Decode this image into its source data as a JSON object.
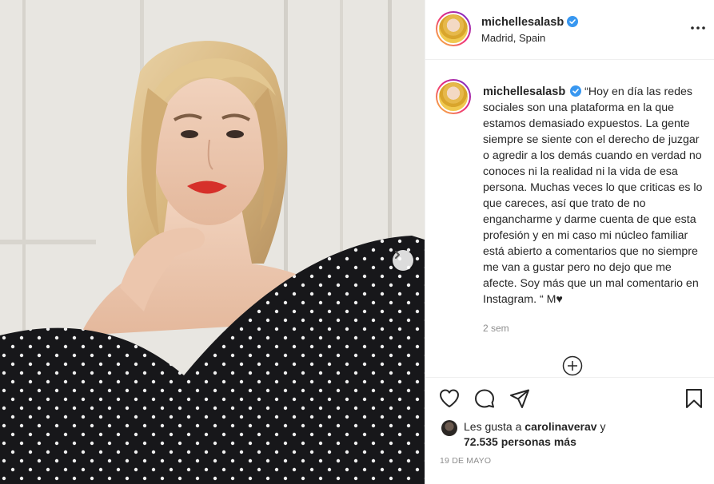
{
  "post": {
    "username": "michellesalasb",
    "location": "Madrid, Spain",
    "caption": "“Hoy en día las redes sociales son una plataforma en la que estamos demasiado expuestos. La gente siempre se siente con el derecho de juzgar o agredir a los demás cuando en verdad no conoces ni la realidad ni la vida de esa persona. Muchas veces lo que criticas es lo que careces, así que trato de no engancharme y darme cuenta de que esta profesión y en mi caso mi núcleo familiar está abierto a comentarios que no siempre me van a gustar pero no dejo que me afecte. Soy más que un mal comentario en Instagram. “ M♥",
    "time_ago": "2 sem",
    "date": "19 DE MAYO"
  },
  "likes": {
    "prefix": "Les gusta a",
    "liker": "carolinaverav",
    "conjunction": "y",
    "count": "72.535 personas más"
  },
  "icons": {
    "verified": "verified-badge-icon",
    "more": "more-options-icon",
    "next": "chevron-right-icon",
    "load_more": "plus-circle-icon",
    "like": "heart-icon",
    "comment": "comment-icon",
    "share": "paper-plane-icon",
    "save": "bookmark-icon"
  },
  "colors": {
    "verified": "#3897f0",
    "text": "#262626",
    "muted": "#8e8e8e",
    "border": "#efefef"
  }
}
